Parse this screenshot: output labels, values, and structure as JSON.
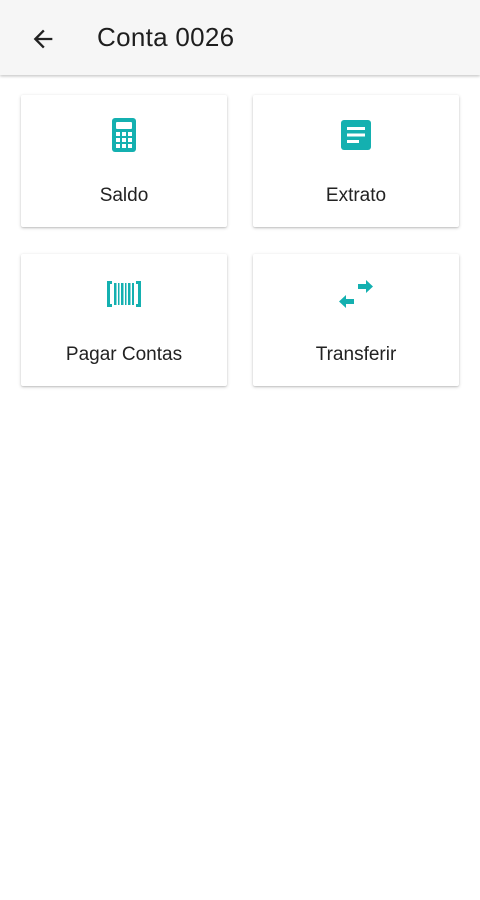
{
  "header": {
    "title": "Conta 0026",
    "back_icon": "arrow-back-icon"
  },
  "colors": {
    "accent": "#14b0b0",
    "app_bar": "#f6f6f6",
    "text": "#222222"
  },
  "menu": {
    "items": [
      {
        "label": "Saldo",
        "icon": "calculator-icon"
      },
      {
        "label": "Extrato",
        "icon": "document-icon"
      },
      {
        "label": "Pagar Contas",
        "icon": "barcode-icon"
      },
      {
        "label": "Transferir",
        "icon": "swap-arrows-icon"
      }
    ]
  }
}
